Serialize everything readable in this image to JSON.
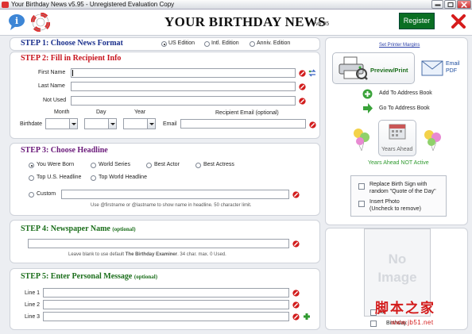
{
  "window": {
    "title": "Your Birthday News v5.95 - Unregistered Evaluation Copy"
  },
  "header": {
    "app_title": "YOUR BIRTHDAY NEWS",
    "version": "v5.95",
    "register_label": "Register"
  },
  "step1": {
    "title": "STEP 1: Choose News Format",
    "options": [
      "US Edition",
      "Intl. Edition",
      "Anniv. Edition"
    ],
    "selected": "US Edition"
  },
  "step2": {
    "title": "STEP 2: Fill in Recipient Info",
    "first_name_label": "First Name",
    "first_name_value": "",
    "last_name_label": "Last Name",
    "not_used_label": "Not Used",
    "month_label": "Month",
    "day_label": "Day",
    "year_label": "Year",
    "birthdate_label": "Birthdate",
    "recipient_email_label": "Recipient Email (optional)",
    "email_label": "Email"
  },
  "step3": {
    "title": "STEP 3: Choose Headline",
    "options": [
      "You Were Born",
      "World Series",
      "Best Actor",
      "Best Actress",
      "Top U.S. Headline",
      "Top World Headline",
      "Custom"
    ],
    "selected": "You Were Born",
    "hint": "Use @firstname or @lastname to show name in headline. 50 character limit."
  },
  "step4": {
    "title": "STEP 4: Newspaper Name",
    "optional": "(optional)",
    "hint": "Leave blank to use default",
    "hint_name": "The Birthday Examiner",
    "hint_tail": ". 34 char. max. 0 Used."
  },
  "step5": {
    "title": "STEP 5: Enter Personal Message",
    "optional": "(optional)",
    "lines": [
      "Line 1",
      "Line 2",
      "Line 3"
    ]
  },
  "right": {
    "printer_margins": "Set Printer Margins",
    "preview_print": "Preview/Print",
    "email_pdf_line1": "Email",
    "email_pdf_line2": "PDF",
    "add_address": "Add To Address Book",
    "goto_address": "Go To Address Book",
    "years_ahead": "Years Ahead",
    "years_ahead_status": "Years Ahead NOT Active",
    "replace_sign_line1": "Replace Birth Sign with",
    "replace_sign_line2": "random \"Quote of the Day\"",
    "insert_photo_line1": "Insert Photo",
    "insert_photo_line2": "(Uncheck to remove)",
    "no_image_line1": "No",
    "no_image_line2": "Image",
    "partial_label_1": "no",
    "partial_label_2": "Birthday"
  },
  "watermark": {
    "text": "脚本之家",
    "url": "www.jb51.net"
  },
  "colors": {
    "step_blue": "#1a2f8c",
    "step_red": "#c8141e",
    "step_purple": "#6a1a7a",
    "step_green": "#1b6e1b",
    "register_green": "#0a6f23",
    "years_green": "#2f9a2f"
  }
}
